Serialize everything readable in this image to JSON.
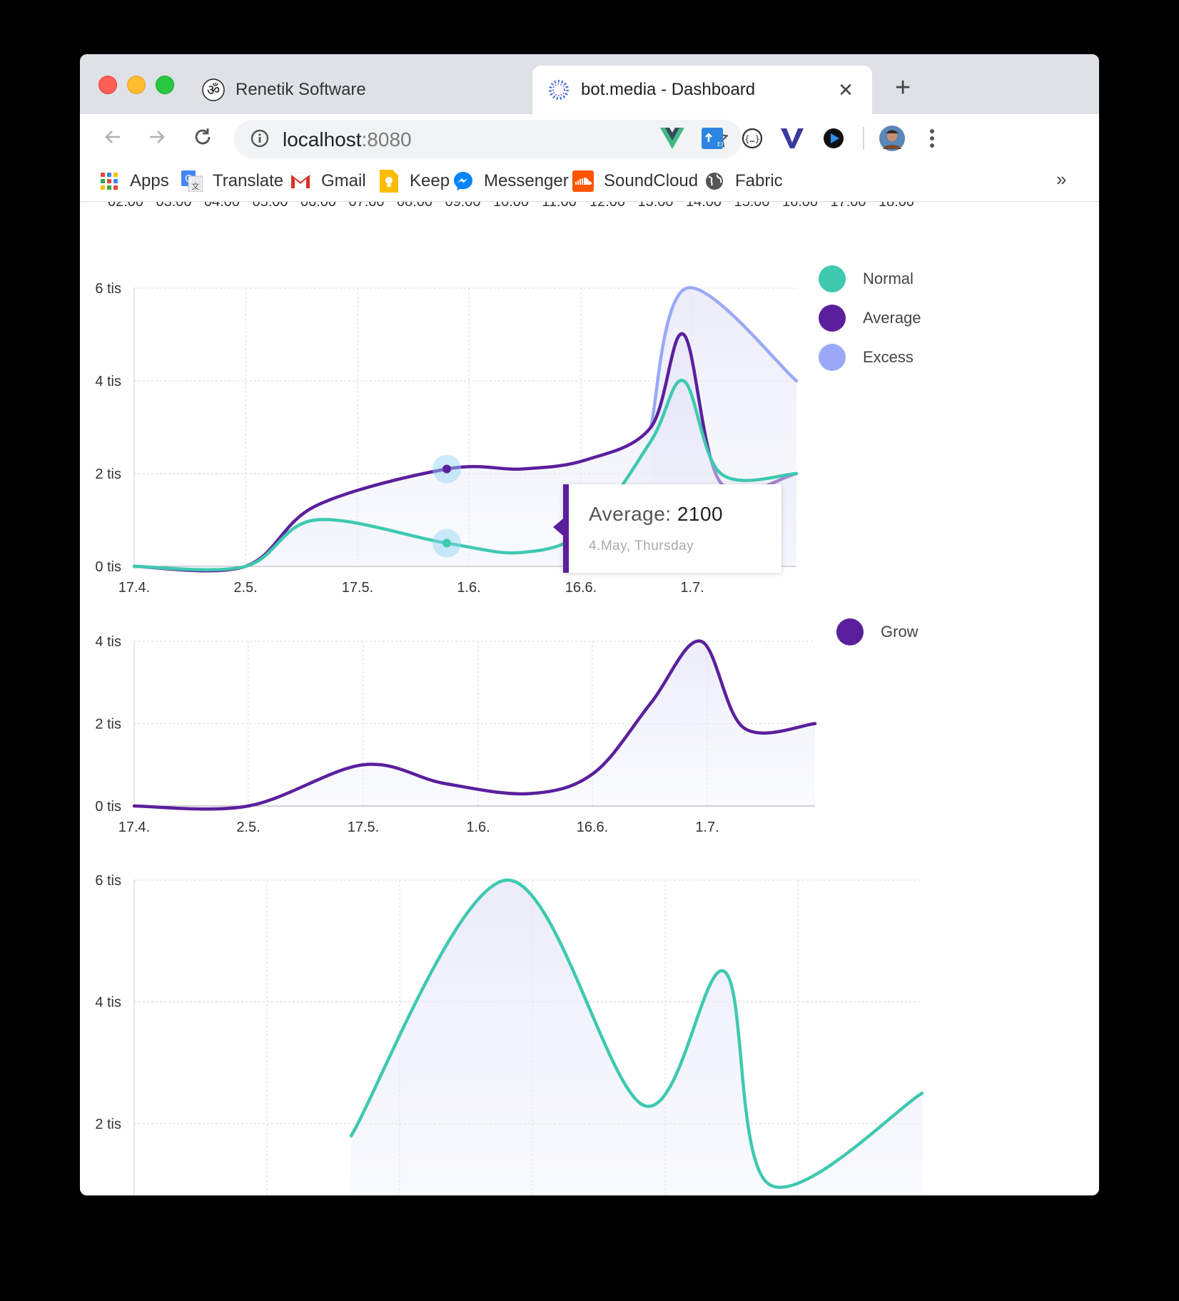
{
  "browser": {
    "tabs": [
      {
        "title": "Renetik Software",
        "icon": "om-icon",
        "active": false
      },
      {
        "title": "bot.media - Dashboard",
        "icon": "dotted-ring-icon",
        "active": true
      }
    ],
    "url_host": "localhost",
    "url_port": ":8080",
    "bookmarks": [
      {
        "label": "Apps",
        "icon": "apps-grid-icon"
      },
      {
        "label": "Translate",
        "icon": "translate-icon"
      },
      {
        "label": "Gmail",
        "icon": "gmail-icon"
      },
      {
        "label": "Keep",
        "icon": "keep-icon"
      },
      {
        "label": "Messenger",
        "icon": "messenger-icon"
      },
      {
        "label": "SoundCloud",
        "icon": "soundcloud-icon"
      },
      {
        "label": "Fabric",
        "icon": "globe-icon"
      }
    ],
    "bookmarks_more": "»"
  },
  "colors": {
    "normal": "#3ec9b0",
    "average": "#5b1f9d",
    "excess": "#9aa9f7",
    "grid": "#d8d8d8",
    "axis_text": "#333333"
  },
  "tooltip": {
    "label": "Average:",
    "value": "2100",
    "date": "4.May, Thursday"
  },
  "chart_data": [
    {
      "type": "area",
      "title": "",
      "x": [
        "17.4.",
        "2.5.",
        "17.5.",
        "1.6.",
        "16.6.",
        "1.7."
      ],
      "y_ticks": [
        "0 tis",
        "2 tis",
        "4 tis",
        "6 tis"
      ],
      "ylim": [
        0,
        6000
      ],
      "grid": true,
      "legend": "right",
      "series": [
        {
          "name": "Normal",
          "color": "#3ec9b0",
          "values": [
            0,
            0,
            1000,
            500,
            300,
            800,
            2700,
            4000,
            2000,
            2000
          ]
        },
        {
          "name": "Average",
          "color": "#5b1f9d",
          "values": [
            0,
            0,
            1300,
            2100,
            2100,
            2300,
            3000,
            5000,
            1800,
            2000
          ]
        },
        {
          "name": "Excess",
          "color": "#9aa9f7",
          "values": [
            3000,
            6000,
            4000
          ]
        }
      ]
    },
    {
      "type": "area",
      "title": "",
      "x": [
        "17.4.",
        "2.5.",
        "17.5.",
        "1.6.",
        "16.6.",
        "1.7."
      ],
      "y_ticks": [
        "0 tis",
        "2 tis",
        "4 tis"
      ],
      "ylim": [
        0,
        4000
      ],
      "grid": true,
      "legend": "right",
      "series": [
        {
          "name": "Grow",
          "color": "#5b1f9d",
          "values": [
            0,
            0,
            1000,
            550,
            300,
            800,
            2500,
            4000,
            1900,
            2000
          ]
        }
      ]
    },
    {
      "type": "area",
      "title": "",
      "y_ticks": [
        "2 tis",
        "4 tis",
        "6 tis"
      ],
      "ylim": [
        0,
        6000
      ],
      "grid": true,
      "series": [
        {
          "color": "#3ec9b0",
          "values": [
            1800,
            6000,
            2300,
            4500,
            1000,
            2500
          ]
        }
      ]
    }
  ]
}
